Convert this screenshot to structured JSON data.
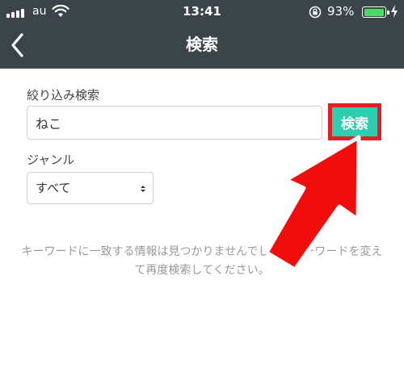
{
  "status_bar": {
    "carrier": "au",
    "time": "13:41",
    "battery_percent": "93%",
    "battery_level": 0.93,
    "battery_color": "#4cd964"
  },
  "nav": {
    "title": "検索",
    "back_icon": "chevron-left-icon"
  },
  "form": {
    "filter_label": "絞り込み検索",
    "keyword_value": "ねこ",
    "search_button_label": "検索",
    "genre_label": "ジャンル",
    "genre_selected": "すべて"
  },
  "empty_message": "キーワードに一致する情報は見つかりませんでした。キーワードを変えて再度検索してください。",
  "colors": {
    "nav_background": "#3b4449",
    "search_button": "#2ecfb0",
    "highlight": "#e31e24"
  }
}
